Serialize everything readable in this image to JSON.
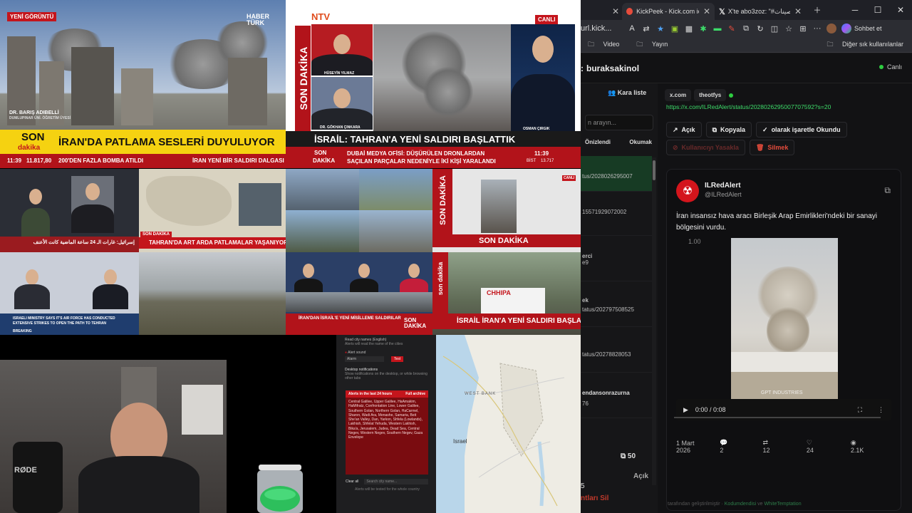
{
  "streams": {
    "t1": {
      "badge": "YENİ GÖRÜNTÜ",
      "logo": "HABER TÜRK",
      "person_caption": "DR. BARIŞ ADIBELLİ",
      "person_sub": "DUMLUPINAR ÜNİ. ÖĞRETİM ÜYESİ",
      "son": "SON",
      "dakika": "dakika",
      "headline": "İRAN'DA PATLAMA SESLERİ DUYULUYOR",
      "time": "11:39",
      "index": "11.817,80",
      "ticker": "200'DEN FAZLA BOMBA ATILDI",
      "ticker2": "İRAN YENİ BİR SALDIRI DALGASI BA"
    },
    "t2": {
      "logo": "NTV",
      "live": "CANLI",
      "vertical": "SON DAKİKA",
      "guest1": "HÜSEYİN YILMAZ",
      "guest2": "DR. GÖKHAN ÇINKARA",
      "host": "OSMAN ÇIRGIK",
      "headline": "İSRAİL: TAHRAN'A YENİ SALDIRI BAŞLATTIK",
      "son": "SON",
      "dakika": "DAKİKA",
      "ticker_line1": "DUBAİ MEDYA OFİSİ: DÜŞÜRÜLEN DRONLARDAN",
      "ticker_line2": "SAÇILAN PARÇALAR NEDENİYLE İKİ KİŞİ YARALANDI",
      "time": "11:39",
      "bist": "BİST",
      "bist_value": "13.717"
    },
    "t5": {
      "son": "SON DAKİKA",
      "headline": "TAHRAN'DA ART ARDA PATLAMALAR YAŞANIYOR",
      "logo": "CNN TÜRK"
    },
    "t7": {
      "vertical": "SON DAKİKA",
      "banner": "SON DAKİKA",
      "live": "CANLI"
    },
    "t11": {
      "headline": "İRAN'DAN İSRAİL'E YENİ MİSİLLEME SALDIRILAR",
      "son": "SON DAKİKA"
    },
    "t12": {
      "son": "son dakika",
      "headline": "İSRAİL İRAN'A YENİ SALDIRI BAŞLATTI",
      "ambulance": "CHHIPA"
    },
    "t8": {
      "ticker": "ISRAELI MINISTRY SAYS IT'S AIR FORCE HAS CONDUCTED EXTENSIVE STRIKES TO OPEN THE PATH TO TEHRAN",
      "tag": "BREAKING"
    },
    "t3": {
      "ar_ticker": "إسرائيل: غارات الـ 24 ساعة الماضية كانت الأعنف"
    }
  },
  "webcam": {
    "mic_brand": "RØDE"
  },
  "alert_panel": {
    "read_city": "Read city names (English)",
    "read_city_sub": "Alerts will read the name of the cities",
    "alert_sound": "Alert sound",
    "sound_value": "Alarm",
    "test": "Test",
    "desktop_notif": "Desktop notifications",
    "desktop_notif_sub": "Show notifications on the desktop, or while browsing other tabs",
    "alerts_title": "Alerts in the last 24 hours",
    "full_archive": "Full archive",
    "alerts_text": "Central Galilee, Upper Galilee, HaAmakim, HaMifratz, Confrontation Line, Lower Galilee, Southern Golan, Northern Golan, HaCarmel, Sharon, Wadi Ara, Menashe, Samaria, Beit She'an Valley, Dan, Yarkon, Shfela (Lowlands), Lakhish, Shfelat Yehuda, Western Lakhish, Bika'a, Jerusalem, Judea, Dead Sea, Central Negev, Western Negev, Southern Negev, Gaza Envelope",
    "clear_all": "Clear all",
    "search_placeholder": "Search city name...",
    "footer": "Alerts will be tested for the whole country"
  },
  "map": {
    "label_westbank": "WEST BANK",
    "label_israel": "Israel"
  },
  "browser": {
    "tabs": [
      {
        "label": "",
        "active": false
      },
      {
        "label": "KickPeek - Kick.com için G",
        "active": true
      },
      {
        "label": "X'te abo3zoz: \"#التحصينات\"",
        "active": false
      }
    ],
    "url": "url.kick...",
    "profile_button": "Sohbet et",
    "bookmarks": [
      "Video",
      "Yayın"
    ],
    "other_bookmarks": "Diğer sık kullanılanlar"
  },
  "app": {
    "channel_prefix": ":",
    "channel": "buraksakinol",
    "status": "Canlı",
    "blacklist": "Kara liste",
    "search_placeholder": "n arayın...",
    "tab_preview": "Önizlendi",
    "tab_read": "Okumak",
    "messages": [
      {
        "text": "tus/2028026295007",
        "selected": true
      },
      {
        "text": "15571929072002",
        "selected": false
      },
      {
        "text": "erci",
        "text2": "e9",
        "selected": false
      },
      {
        "text": "ek",
        "text2": "tatus/202797508525",
        "selected": false
      },
      {
        "text": "tatus/20278828053",
        "selected": false
      },
      {
        "text": "endansonrazurna",
        "text2": "76",
        "selected": false
      }
    ],
    "count": "50",
    "count_left": "5",
    "open_left": "Açık",
    "delete_selected": "ntları Sil",
    "pills": [
      "x.com",
      "theotfys"
    ],
    "post_url": "https://x.com/ILRedAlert/status/2028026295007707592?s=20",
    "btn_open": "Açık",
    "btn_copy": "Kopyala",
    "btn_mark_read": "olarak işaretle Okundu",
    "btn_block_user": "Kullanıcıyı Yasakla",
    "btn_delete": "Silmek",
    "tweet": {
      "name": "ILRedAlert",
      "handle": "@ILRedAlert",
      "text": "İran insansız hava aracı Birleşik Arap Emirlikleri'ndeki bir sanayi bölgesini vurdu.",
      "zoom": "1.00",
      "video_time": "0:00 / 0:08",
      "video_watermark": "GPT INDUSTRIES",
      "date": "1 Mart 2026",
      "replies": "2",
      "retweets": "12",
      "likes": "24",
      "views": "2.1K"
    },
    "footer_prefix": "tarafından geliştirilmiştir",
    "footer_dev1": "Kodumdendisi",
    "footer_and": "ve",
    "footer_dev2": "WhiteTemptation"
  },
  "colors": {
    "accent_green": "#3ddc6a",
    "news_red": "#b2131a",
    "danger": "#e74c3c",
    "online": "#2ecc40"
  }
}
